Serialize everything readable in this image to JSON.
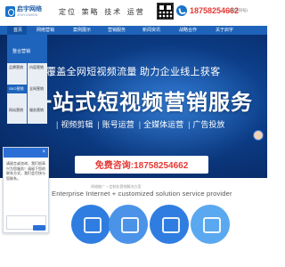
{
  "header": {
    "logo_name": "启宇网络",
    "logo_en": "JINYOWEB",
    "slogan": [
      "定位",
      "策略",
      "技术",
      "运营"
    ],
    "phone": "18758254662",
    "wechat_note": "(微信同号)"
  },
  "nav": {
    "items": [
      "首页",
      "网络营销",
      "案例展示",
      "营销服务",
      "新闻资讯",
      "战略合作",
      "关于启宇"
    ]
  },
  "dropdown": {
    "head": "整合营销",
    "col1": [
      "品牌营销",
      "SEO营销",
      "网站营销"
    ],
    "col2": [
      "内容营销",
      "全网营销",
      "服务营销"
    ]
  },
  "hero": {
    "line1": "覆盖全网短视频流量  助力企业线上获客",
    "title": "一站式短视频营销服务",
    "services": [
      "视频剪辑",
      "账号运营",
      "全媒体运营",
      "广告投放"
    ],
    "consult_label": "免费咨询:",
    "consult_number": "18758254662"
  },
  "chat": {
    "message": "请留言或咨询，我们很高兴为您服务！请留下您的联系方式，我们会尽快与您联系。",
    "close": "×"
  },
  "section": {
    "subtitle": "网络推广 + 定制化营销解决方案",
    "title": "Enterprise Internet + customized solution service provider"
  },
  "colors": {
    "brand_blue": "#1e63b9",
    "accent_red": "#e53935",
    "circle_blue": "#2f7de0",
    "circle_light": "#5aa8f0"
  }
}
